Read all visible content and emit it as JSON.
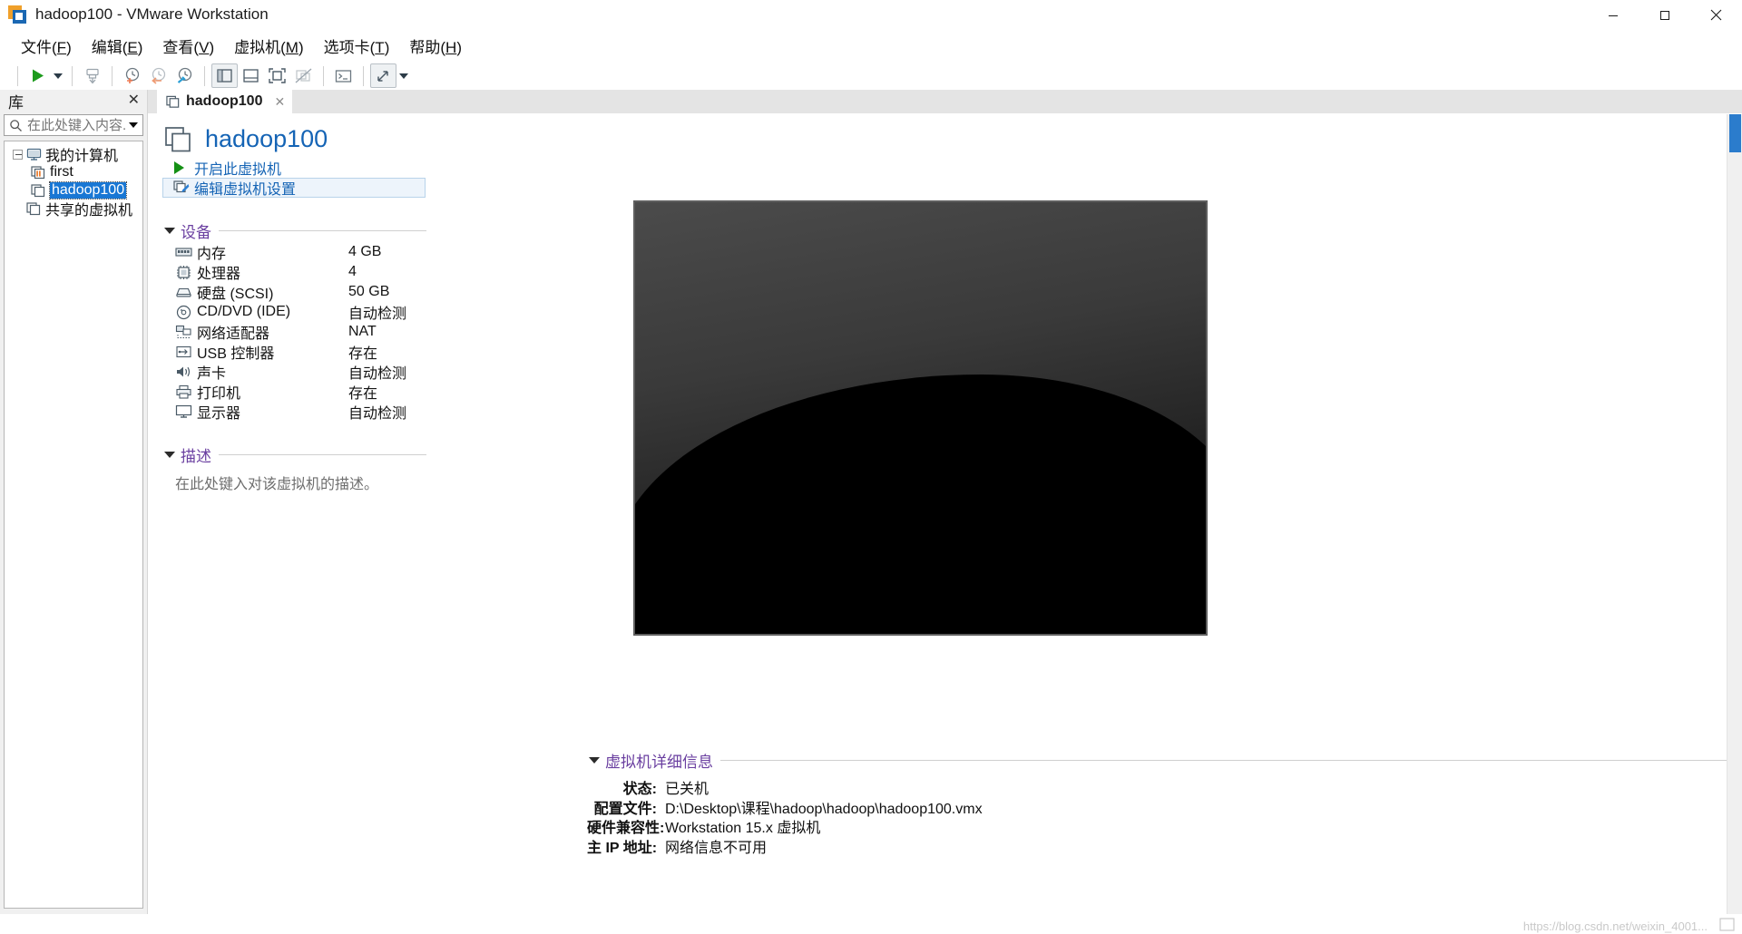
{
  "window": {
    "title": "hadoop100 - VMware Workstation",
    "logo_icon": "vmware-logo-icon",
    "controls": [
      {
        "name": "minimize-button",
        "icon": "minimize-icon"
      },
      {
        "name": "maximize-button",
        "icon": "maximize-icon"
      },
      {
        "name": "close-button",
        "icon": "close-icon"
      }
    ]
  },
  "menubar": {
    "items": [
      {
        "label": "文件(F)",
        "accel": "F",
        "name": "menu-file"
      },
      {
        "label": "编辑(E)",
        "accel": "E",
        "name": "menu-edit"
      },
      {
        "label": "查看(V)",
        "accel": "V",
        "name": "menu-view"
      },
      {
        "label": "虚拟机(M)",
        "accel": "M",
        "name": "menu-vm"
      },
      {
        "label": "选项卡(T)",
        "accel": "T",
        "name": "menu-tabs"
      },
      {
        "label": "帮助(H)",
        "accel": "H",
        "name": "menu-help"
      }
    ]
  },
  "toolbar": {
    "buttons": [
      {
        "name": "power-on-button",
        "icon": "play-icon"
      },
      {
        "name": "power-dropdown-button",
        "icon": "chevron-down-icon"
      },
      {
        "name": "send-ctrl-alt-del-button",
        "icon": "keyboard-send-icon"
      },
      {
        "name": "take-snapshot-button",
        "icon": "snapshot-add-icon"
      },
      {
        "name": "revert-snapshot-button",
        "icon": "snapshot-revert-icon"
      },
      {
        "name": "snapshot-manager-button",
        "icon": "snapshot-manage-icon"
      },
      {
        "name": "show-library-button",
        "icon": "panel-left-icon"
      },
      {
        "name": "show-thumbnail-bar-button",
        "icon": "panel-bottom-icon"
      },
      {
        "name": "full-screen-button",
        "icon": "fullscreen-icon"
      },
      {
        "name": "unity-mode-button",
        "icon": "unity-disabled-icon"
      },
      {
        "name": "console-button",
        "icon": "terminal-icon"
      },
      {
        "name": "stretch-guest-button",
        "icon": "resize-arrows-icon"
      },
      {
        "name": "stretch-dropdown-button",
        "icon": "chevron-down-icon"
      }
    ]
  },
  "sidebar": {
    "title": "库",
    "close_icon": "close-icon",
    "search": {
      "placeholder": "在此处键入内容...",
      "value": "",
      "icon": "search-icon",
      "dropdown_icon": "chevron-down-icon"
    },
    "tree": [
      {
        "label": "我的计算机",
        "name": "tree-item-my-computer",
        "icon": "monitor-icon",
        "level": 0,
        "selected": false,
        "expanded": true
      },
      {
        "label": "first",
        "name": "tree-item-first",
        "icon": "vm-running-icon",
        "level": 1,
        "selected": false
      },
      {
        "label": "hadoop100",
        "name": "tree-item-hadoop100",
        "icon": "vm-off-icon",
        "level": 1,
        "selected": true
      },
      {
        "label": "共享的虚拟机",
        "name": "tree-item-shared-vms",
        "icon": "shared-vm-icon",
        "level": 0,
        "selected": false
      }
    ]
  },
  "main": {
    "tab": {
      "label": "hadoop100",
      "icon": "vm-off-icon",
      "close_icon": "close-icon"
    },
    "vm_title": "hadoop100",
    "vm_title_icon": "vm-off-icon",
    "actions": [
      {
        "label": "开启此虚拟机",
        "name": "power-on-link",
        "icon": "play-icon",
        "hovered": false
      },
      {
        "label": "编辑虚拟机设置",
        "name": "edit-vm-settings-link",
        "icon": "edit-settings-icon",
        "hovered": true
      }
    ],
    "devices_section": {
      "title": "设备",
      "caret_icon": "caret-down-icon",
      "rows": [
        {
          "name": "device-row-memory",
          "icon": "memory-icon",
          "label": "内存",
          "value": "4 GB"
        },
        {
          "name": "device-row-processors",
          "icon": "cpu-icon",
          "label": "处理器",
          "value": "4"
        },
        {
          "name": "device-row-harddisk",
          "icon": "harddisk-icon",
          "label": "硬盘 (SCSI)",
          "value": "50 GB"
        },
        {
          "name": "device-row-cddvd",
          "icon": "disc-icon",
          "label": "CD/DVD (IDE)",
          "value": "自动检测"
        },
        {
          "name": "device-row-network",
          "icon": "network-icon",
          "label": "网络适配器",
          "value": "NAT"
        },
        {
          "name": "device-row-usb",
          "icon": "usb-icon",
          "label": "USB 控制器",
          "value": "存在"
        },
        {
          "name": "device-row-sound",
          "icon": "speaker-icon",
          "label": "声卡",
          "value": "自动检测"
        },
        {
          "name": "device-row-printer",
          "icon": "printer-icon",
          "label": "打印机",
          "value": "存在"
        },
        {
          "name": "device-row-display",
          "icon": "display-icon",
          "label": "显示器",
          "value": "自动检测"
        }
      ]
    },
    "description_section": {
      "title": "描述",
      "caret_icon": "caret-down-icon",
      "placeholder_text": "在此处键入对该虚拟机的描述。"
    },
    "details_section": {
      "title": "虚拟机详细信息",
      "caret_icon": "caret-down-icon",
      "rows": [
        {
          "name": "detail-row-state",
          "key": "状态:",
          "value": "已关机"
        },
        {
          "name": "detail-row-config-file",
          "key": "配置文件:",
          "value": "D:\\Desktop\\课程\\hadoop\\hadoop\\hadoop100.vmx"
        },
        {
          "name": "detail-row-hw-compat",
          "key": "硬件兼容性:",
          "value": "Workstation 15.x 虚拟机"
        },
        {
          "name": "detail-row-primary-ip",
          "key": "主 IP 地址:",
          "value": "网络信息不可用"
        }
      ]
    },
    "thumbnail": {
      "name": "vm-screen-thumbnail",
      "alt": "vm-powered-off-wallpaper"
    }
  },
  "scrollbar": {
    "name": "vertical-scrollbar",
    "thumb_name": "scrollbar-thumb"
  },
  "watermark": {
    "text": "https://blog.csdn.net/weixin_4001..."
  },
  "colors": {
    "accent_blue": "#1564b5",
    "section_purple": "#6a3fa0",
    "selection_blue": "#1977d4",
    "play_green": "#159015",
    "window_bg": "#ffffff",
    "sidebar_bg": "#f0f0f0",
    "scroll_thumb": "#2b7ccc"
  }
}
